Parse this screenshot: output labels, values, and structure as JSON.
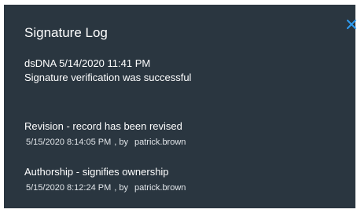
{
  "dialog": {
    "title": "Signature Log",
    "close_icon": "close-icon",
    "accent_color": "#2e9bf0",
    "background_color": "#2a3640"
  },
  "signature": {
    "header": "dsDNA 5/14/2020 11:41 PM",
    "status": "Signature verification was successful"
  },
  "entries": [
    {
      "title": "Revision - record has been revised",
      "timestamp": "5/15/2020 8:14:05 PM",
      "by": ", by",
      "user": "patrick.brown"
    },
    {
      "title": "Authorship - signifies ownership",
      "timestamp": "5/15/2020 8:12:24 PM",
      "by": ", by",
      "user": "patrick.brown"
    }
  ]
}
